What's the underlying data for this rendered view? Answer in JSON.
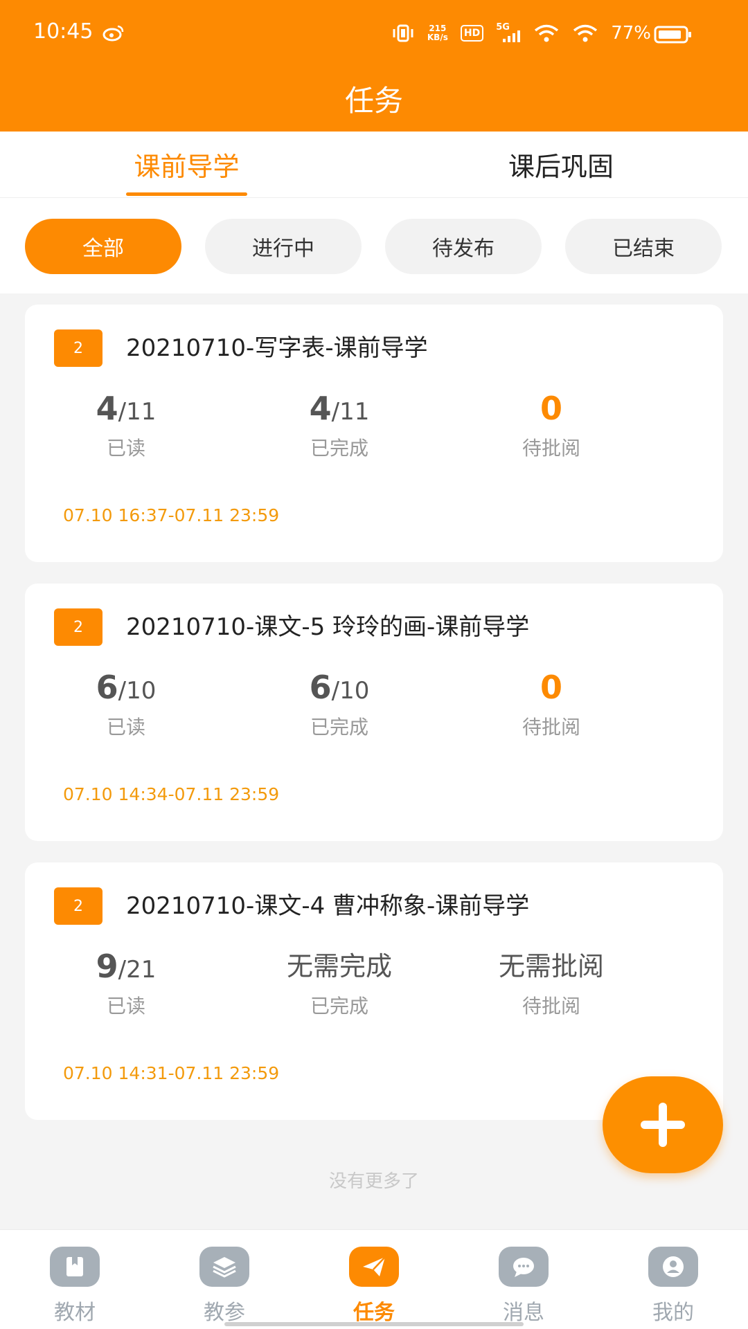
{
  "status_bar": {
    "time": "10:45",
    "net_speed_value": "215",
    "net_speed_unit": "KB/s",
    "hd_label": "HD",
    "network_label": "5G",
    "battery_percent": "77%"
  },
  "header": {
    "title": "任务"
  },
  "tabs": [
    {
      "label": "课前导学",
      "active": true
    },
    {
      "label": "课后巩固",
      "active": false
    }
  ],
  "filters": [
    {
      "label": "全部",
      "active": true
    },
    {
      "label": "进行中",
      "active": false
    },
    {
      "label": "待发布",
      "active": false
    },
    {
      "label": "已结束",
      "active": false
    }
  ],
  "tasks": [
    {
      "badge": "2",
      "title": "20210710-写字表-课前导学",
      "read": {
        "count": "4",
        "total": "/11",
        "label": "已读"
      },
      "completed": {
        "count": "4",
        "total": "/11",
        "label": "已完成"
      },
      "review": {
        "value": "0",
        "label": "待批阅"
      },
      "time_range": "07.10  16:37-07.11  23:59"
    },
    {
      "badge": "2",
      "title": "20210710-课文-5  玲玲的画-课前导学",
      "read": {
        "count": "6",
        "total": "/10",
        "label": "已读"
      },
      "completed": {
        "count": "6",
        "total": "/10",
        "label": "已完成"
      },
      "review": {
        "value": "0",
        "label": "待批阅"
      },
      "time_range": "07.10  14:34-07.11  23:59"
    },
    {
      "badge": "2",
      "title": "20210710-课文-4  曹冲称象-课前导学",
      "read": {
        "count": "9",
        "total": "/21",
        "label": "已读"
      },
      "completed": {
        "text": "无需完成",
        "label": "已完成"
      },
      "review": {
        "text": "无需批阅",
        "label": "待批阅"
      },
      "time_range": "07.10  14:31-07.11  23:59"
    }
  ],
  "list_footer": "没有更多了",
  "fab": {
    "icon": "plus-icon"
  },
  "bottom_nav": [
    {
      "label": "教材",
      "icon": "book-icon",
      "active": false
    },
    {
      "label": "教参",
      "icon": "layers-icon",
      "active": false
    },
    {
      "label": "任务",
      "icon": "paper-plane-icon",
      "active": true
    },
    {
      "label": "消息",
      "icon": "chat-bubble-icon",
      "active": false
    },
    {
      "label": "我的",
      "icon": "user-icon",
      "active": false
    }
  ],
  "colors": {
    "accent": "#fd8a02",
    "time_text": "#f39a0c",
    "inactive_nav": "#a7b0b8",
    "background": "#f4f4f4"
  }
}
